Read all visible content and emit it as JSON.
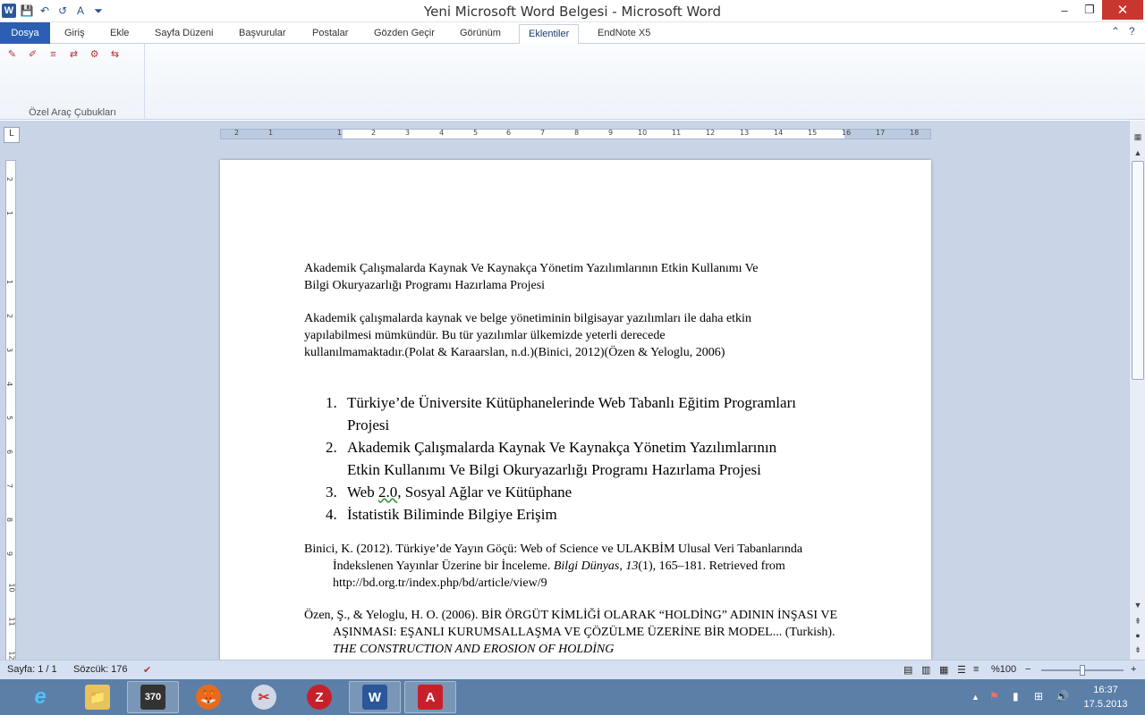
{
  "window": {
    "title": "Yeni Microsoft Word Belgesi  -  Microsoft Word",
    "minimize": "–",
    "restore": "❐",
    "close": "✕"
  },
  "quick_access": {
    "logo": "W",
    "save": "💾",
    "undo": "↶",
    "redo": "↺",
    "font": "A",
    "customize": "⏷"
  },
  "ribbon": {
    "tabs": [
      "Dosya",
      "Giriş",
      "Ekle",
      "Sayfa Düzeni",
      "Başvurular",
      "Postalar",
      "Gözden Geçir",
      "Görünüm",
      "Eklentiler",
      "EndNote X5"
    ],
    "active_tab": "Eklentiler",
    "group_label": "Özel Araç Çubukları",
    "help_icon": "?",
    "collapse_icon": "⌃",
    "toolbar_icons": [
      "✎",
      "✐",
      "≡",
      "⇄",
      "⚙",
      "⇆"
    ]
  },
  "ruler": {
    "tab_selector": "L",
    "horizontal_numbers": [
      "2",
      "1",
      "1",
      "2",
      "3",
      "4",
      "5",
      "6",
      "7",
      "8",
      "9",
      "10",
      "11",
      "12",
      "13",
      "14",
      "15",
      "16",
      "17",
      "18"
    ],
    "vertical_numbers": [
      "2",
      "1",
      "1",
      "2",
      "3",
      "4",
      "5",
      "6",
      "7",
      "8",
      "9",
      "10",
      "11",
      "12"
    ]
  },
  "document": {
    "title_line1": "Akademik Çalışmalarda Kaynak Ve Kaynakça Yönetim Yazılımlarının  Etkin Kullanımı Ve",
    "title_line2": "Bilgi Okuryazarlığı Programı Hazırlama Projesi",
    "para_line1": "Akademik çalışmalarda kaynak ve belge yönetiminin bilgisayar yazılımları ile daha etkin",
    "para_line2": "yapılabilmesi  mümkündür. Bu tür yazılımlar ülkemizde yeterli derecede",
    "para_line3": "kullanılmamaktadır.(Polat  & Karaarslan, n.d.)(Binici, 2012)(Özen & Yeloglu, 2006)",
    "list": [
      {
        "num": "1.",
        "line1": "Türkiye’de Üniversite Kütüphanelerinde Web Tabanlı Eğitim Programları",
        "line2": "Projesi"
      },
      {
        "num": "2.",
        "line1": "Akademik Çalışmalarda Kaynak Ve Kaynakça Yönetim Yazılımlarının",
        "line2": "Etkin Kullanımı Ve Bilgi Okuryazarlığı Programı Hazırlama Projesi"
      },
      {
        "num": "3.",
        "line1_a": "Web ",
        "line1_b": "2.0",
        "line1_c": ", Sosyal Ağlar ve Kütüphane"
      },
      {
        "num": "4.",
        "line1": "İstatistik Biliminde Bilgiye Erişim"
      }
    ],
    "ref1": {
      "a": "Binici, K. (2012). Türkiye’de Yayın Göçü: Web of Science ve ULAKBİM Ulusal Veri Tabanlarında İndekslenen Yayınlar Üzerine bir İnceleme. ",
      "journal": "Bilgi Dünyas",
      "b": ", ",
      "vol": "13",
      "c": "(1), 165–181. Retrieved from http://bd.org.tr/index.php/bd/article/view/9"
    },
    "ref2": {
      "a": "Özen, Ş., & Yeloglu, H. O. (2006). BİR ÖRGÜT KİMLİĞİ OLARAK “HOLDİNG” ADININ İNŞASI VE AŞINMASI: EŞANLI KURUMSALLAŞMA VE ÇÖZÜLME ÜZERİNE BİR MODEL... (Turkish).  ",
      "italic": "THE CONSTRUCTION AND EROSION OF HOLDİNG"
    }
  },
  "statusbar": {
    "page": "Sayfa: 1 / 1",
    "words": "Sözcük: 176",
    "zoom": "%100",
    "zoom_level_percent": 100,
    "zoom_minus": "−",
    "zoom_plus": "+"
  },
  "taskbar": {
    "apps": [
      "e",
      "📁",
      "370",
      "🦊",
      "✂",
      "Z",
      "W",
      "A"
    ],
    "tray": {
      "arrow": "▲",
      "flag": "⚑",
      "signal": "▮",
      "network": "⊞",
      "volume": "🔊"
    },
    "time": "16:37",
    "date": "17.5.2013"
  }
}
